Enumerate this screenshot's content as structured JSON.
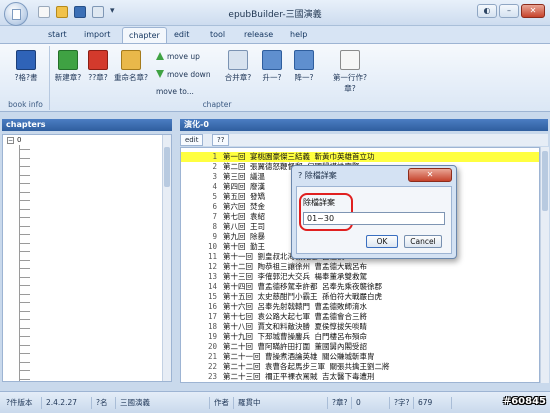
{
  "window": {
    "title": "epubBuilder-三國演義"
  },
  "tabs": [
    "start",
    "import",
    "chapter",
    "edit",
    "tool",
    "release",
    "help"
  ],
  "ribbon": {
    "book_info": {
      "label": "book info",
      "button": "?格?書"
    },
    "chapter_group": {
      "label": "chapter",
      "new_btn": "新建章?",
      "delete_btn": "??章?",
      "rename_btn": "重命名章?",
      "move_up": "move up",
      "move_down": "move down",
      "move_to": "move to...",
      "merge_btn": "合并章?",
      "promote_btn": "升一?",
      "demote_btn": "降一?",
      "first_line_btn": "第一行作?章?"
    }
  },
  "chapters_pane": {
    "title": "chapters",
    "root": "0"
  },
  "editor": {
    "title": "演化-0",
    "tabs": [
      "edit",
      "??"
    ],
    "lines": [
      {
        "n": "1",
        "t": "第一回  宴桃園豪傑三結義  斬黃巾英雄首立功"
      },
      {
        "n": "2",
        "t": "第二回  張翼德怒鞭督郵  何國舅謀誅宦豎"
      },
      {
        "n": "3",
        "t": "第三回  議溫"
      },
      {
        "n": "4",
        "t": "第四回  廢漢"
      },
      {
        "n": "5",
        "t": "第五回  發矯"
      },
      {
        "n": "6",
        "t": "第六回  焚金"
      },
      {
        "n": "7",
        "t": "第七回  袁紹"
      },
      {
        "n": "8",
        "t": "第八回  王司"
      },
      {
        "n": "9",
        "t": "第九回  除暴"
      },
      {
        "n": "10",
        "t": "第十回  勤王"
      },
      {
        "n": "11",
        "t": "第十一回  劉皇叔北海救孔融  呂溫侯"
      },
      {
        "n": "12",
        "t": "第十二回  陶恭祖三讓徐州  曹孟德大戰呂布"
      },
      {
        "n": "13",
        "t": "第十三回  李傕郭汜大交兵  楊奉董承雙救駕"
      },
      {
        "n": "14",
        "t": "第十四回  曹孟德移駕幸許都  呂奉先乘夜襲徐郡"
      },
      {
        "n": "15",
        "t": "第十五回  太史慈酣鬥小霸王  孫伯符大戰嚴白虎"
      },
      {
        "n": "16",
        "t": "第十六回  呂奉先射戟轅門  曹孟德敗師淯水"
      },
      {
        "n": "17",
        "t": "第十七回  袁公路大起七軍  曹孟德會合三將"
      },
      {
        "n": "18",
        "t": "第十八回  賈文和料敵決勝  夏侯惇拔矢啖睛"
      },
      {
        "n": "19",
        "t": "第十九回  下邳城曹操鏖兵  白門樓呂布殞命"
      },
      {
        "n": "20",
        "t": "第二十回  曹阿瞞許田打圍  董國舅內閣受詔"
      },
      {
        "n": "21",
        "t": "第二十一回  曹操煮酒論英雄  關公賺城斬車冑"
      },
      {
        "n": "22",
        "t": "第二十二回  袁曹各起馬步三軍  關張共擒王劉二將"
      },
      {
        "n": "23",
        "t": "第二十三回  禰正平裸衣罵賊  吉太醫下毒遭刑"
      }
    ]
  },
  "dialog": {
    "title": "?  除檔詳案",
    "close": "✕",
    "label": "除檔詳案",
    "input_value": "01~30",
    "ok": "OK",
    "cancel": "Cancel"
  },
  "status": {
    "version_label": "?件版本",
    "version": "2.4.2.27",
    "name_label": "?名",
    "name": "三國演義",
    "author_label": "作者",
    "author": "羅貫中",
    "chapter_label": "?章?",
    "chapter_count": "0",
    "char_label": "?字?",
    "char_count": "679"
  },
  "watermark": "#60845"
}
